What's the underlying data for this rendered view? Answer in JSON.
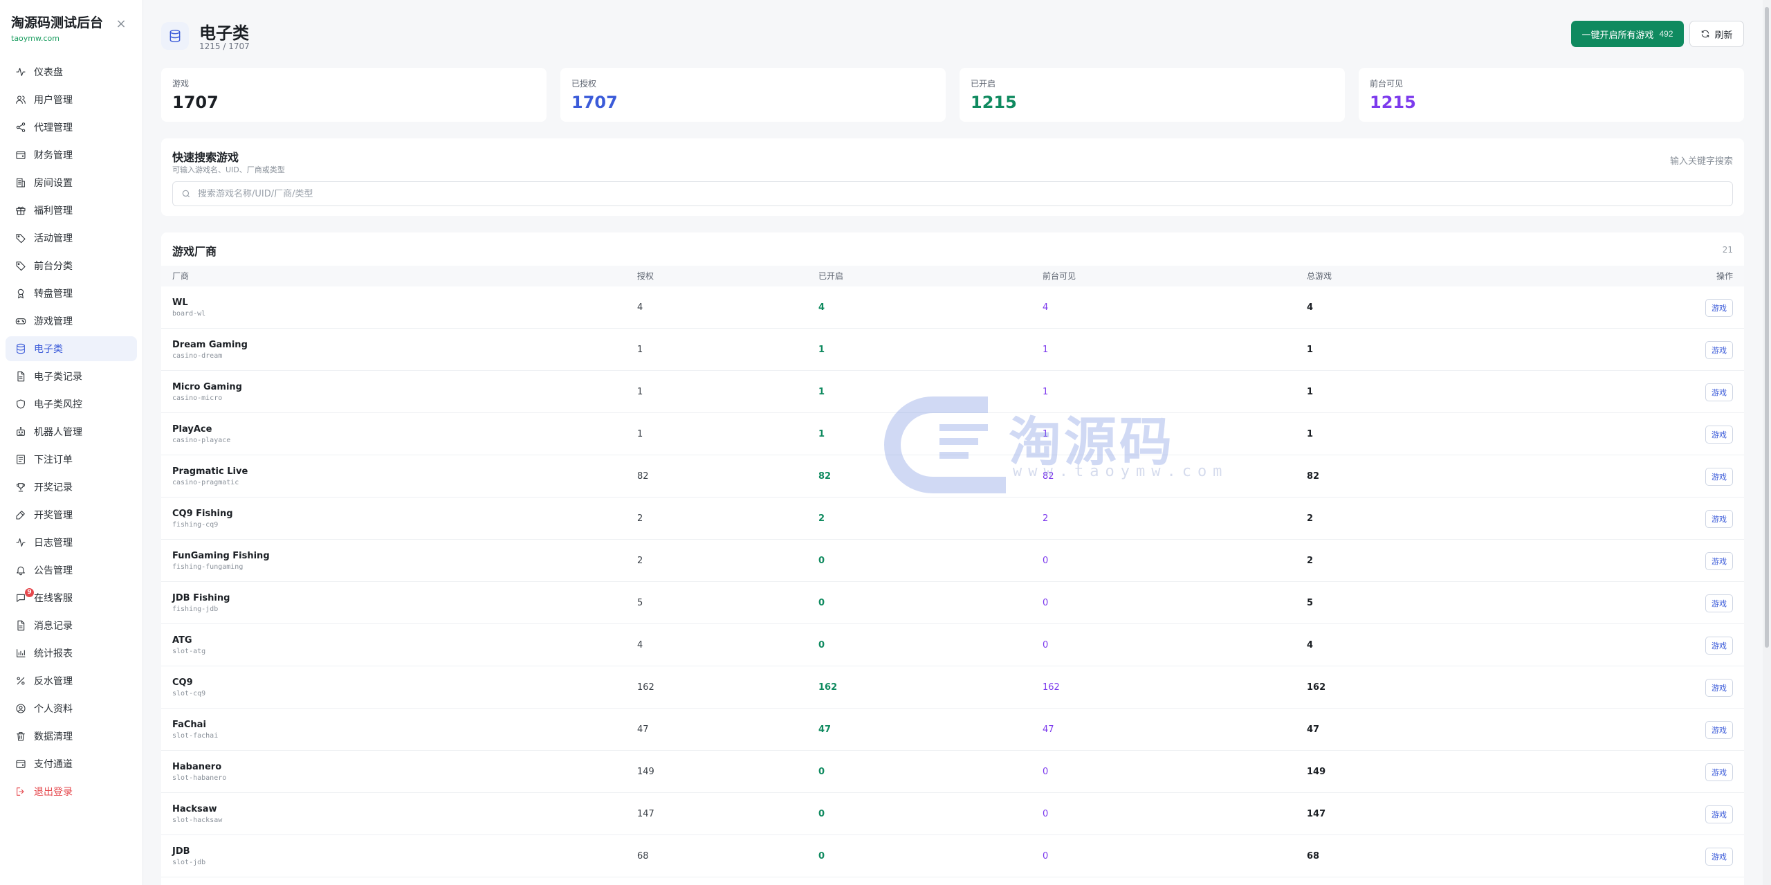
{
  "brand": {
    "title": "淘源码测试后台",
    "subtitle": "taoymw.com"
  },
  "nav": [
    {
      "key": "dashboard",
      "label": "仪表盘",
      "icon": "activity-icon"
    },
    {
      "key": "users",
      "label": "用户管理",
      "icon": "users-icon"
    },
    {
      "key": "agents",
      "label": "代理管理",
      "icon": "share-icon"
    },
    {
      "key": "finance",
      "label": "财务管理",
      "icon": "wallet-icon"
    },
    {
      "key": "rooms",
      "label": "房间设置",
      "icon": "building-icon"
    },
    {
      "key": "welfare",
      "label": "福利管理",
      "icon": "gift-icon"
    },
    {
      "key": "activity",
      "label": "活动管理",
      "icon": "tag-icon"
    },
    {
      "key": "front-category",
      "label": "前台分类",
      "icon": "tag-icon"
    },
    {
      "key": "wheel",
      "label": "转盘管理",
      "icon": "award-icon"
    },
    {
      "key": "games",
      "label": "游戏管理",
      "icon": "gamepad-icon"
    },
    {
      "key": "electronic",
      "label": "电子类",
      "icon": "database-icon",
      "active": true
    },
    {
      "key": "electronic-records",
      "label": "电子类记录",
      "icon": "file-icon"
    },
    {
      "key": "electronic-risk",
      "label": "电子类风控",
      "icon": "shield-icon"
    },
    {
      "key": "robots",
      "label": "机器人管理",
      "icon": "bot-icon"
    },
    {
      "key": "orders",
      "label": "下注订单",
      "icon": "receipt-icon"
    },
    {
      "key": "draws",
      "label": "开奖记录",
      "icon": "trophy-icon"
    },
    {
      "key": "draw-manage",
      "label": "开奖管理",
      "icon": "edit-icon"
    },
    {
      "key": "logs",
      "label": "日志管理",
      "icon": "activity-icon"
    },
    {
      "key": "notices",
      "label": "公告管理",
      "icon": "bell-icon"
    },
    {
      "key": "support",
      "label": "在线客服",
      "icon": "message-icon",
      "badge": "9"
    },
    {
      "key": "messages",
      "label": "消息记录",
      "icon": "file-icon"
    },
    {
      "key": "reports",
      "label": "统计报表",
      "icon": "bar-chart-icon"
    },
    {
      "key": "rebate",
      "label": "反水管理",
      "icon": "percent-icon"
    },
    {
      "key": "profile",
      "label": "个人资料",
      "icon": "user-circle-icon"
    },
    {
      "key": "cleanup",
      "label": "数据清理",
      "icon": "trash-icon"
    },
    {
      "key": "payment",
      "label": "支付通道",
      "icon": "wallet-icon"
    },
    {
      "key": "logout",
      "label": "退出登录",
      "icon": "logout-icon",
      "danger": true
    }
  ],
  "page": {
    "title": "电子类",
    "subtitle": "1215 / 1707",
    "enable_all_label": "一键开启所有游戏",
    "enable_all_count": "492",
    "refresh_label": "刷新"
  },
  "stats": [
    {
      "label": "游戏",
      "value": "1707",
      "color": "#1b1f24"
    },
    {
      "label": "已授权",
      "value": "1707",
      "color": "#3b5bd9"
    },
    {
      "label": "已开启",
      "value": "1215",
      "color": "#0f8a5f"
    },
    {
      "label": "前台可见",
      "value": "1215",
      "color": "#7c3aed"
    }
  ],
  "search": {
    "title": "快速搜索游戏",
    "desc": "可输入游戏名、UID、厂商或类型",
    "hint": "输入关键字搜索",
    "placeholder": "搜索游戏名称/UID/厂商/类型",
    "value": ""
  },
  "vendors": {
    "title": "游戏厂商",
    "count": "21",
    "columns": [
      "厂商",
      "授权",
      "已开启",
      "前台可见",
      "总游戏",
      "操作"
    ],
    "action_label": "游戏",
    "rows": [
      {
        "name": "WL",
        "code": "board-wl",
        "auth": "4",
        "on": "4",
        "visible": "4",
        "total": "4"
      },
      {
        "name": "Dream Gaming",
        "code": "casino-dream",
        "auth": "1",
        "on": "1",
        "visible": "1",
        "total": "1"
      },
      {
        "name": "Micro Gaming",
        "code": "casino-micro",
        "auth": "1",
        "on": "1",
        "visible": "1",
        "total": "1"
      },
      {
        "name": "PlayAce",
        "code": "casino-playace",
        "auth": "1",
        "on": "1",
        "visible": "1",
        "total": "1"
      },
      {
        "name": "Pragmatic Live",
        "code": "casino-pragmatic",
        "auth": "82",
        "on": "82",
        "visible": "82",
        "total": "82"
      },
      {
        "name": "CQ9 Fishing",
        "code": "fishing-cq9",
        "auth": "2",
        "on": "2",
        "visible": "2",
        "total": "2"
      },
      {
        "name": "FunGaming Fishing",
        "code": "fishing-fungaming",
        "auth": "2",
        "on": "0",
        "visible": "0",
        "total": "2"
      },
      {
        "name": "JDB Fishing",
        "code": "fishing-jdb",
        "auth": "5",
        "on": "0",
        "visible": "0",
        "total": "5"
      },
      {
        "name": "ATG",
        "code": "slot-atg",
        "auth": "4",
        "on": "0",
        "visible": "0",
        "total": "4"
      },
      {
        "name": "CQ9",
        "code": "slot-cq9",
        "auth": "162",
        "on": "162",
        "visible": "162",
        "total": "162"
      },
      {
        "name": "FaChai",
        "code": "slot-fachai",
        "auth": "47",
        "on": "47",
        "visible": "47",
        "total": "47"
      },
      {
        "name": "Habanero",
        "code": "slot-habanero",
        "auth": "149",
        "on": "0",
        "visible": "0",
        "total": "149"
      },
      {
        "name": "Hacksaw",
        "code": "slot-hacksaw",
        "auth": "147",
        "on": "0",
        "visible": "0",
        "total": "147"
      },
      {
        "name": "JDB",
        "code": "slot-jdb",
        "auth": "68",
        "on": "0",
        "visible": "0",
        "total": "68"
      }
    ]
  },
  "watermark": {
    "text": "淘源码",
    "url": "www.taoymw.com"
  }
}
